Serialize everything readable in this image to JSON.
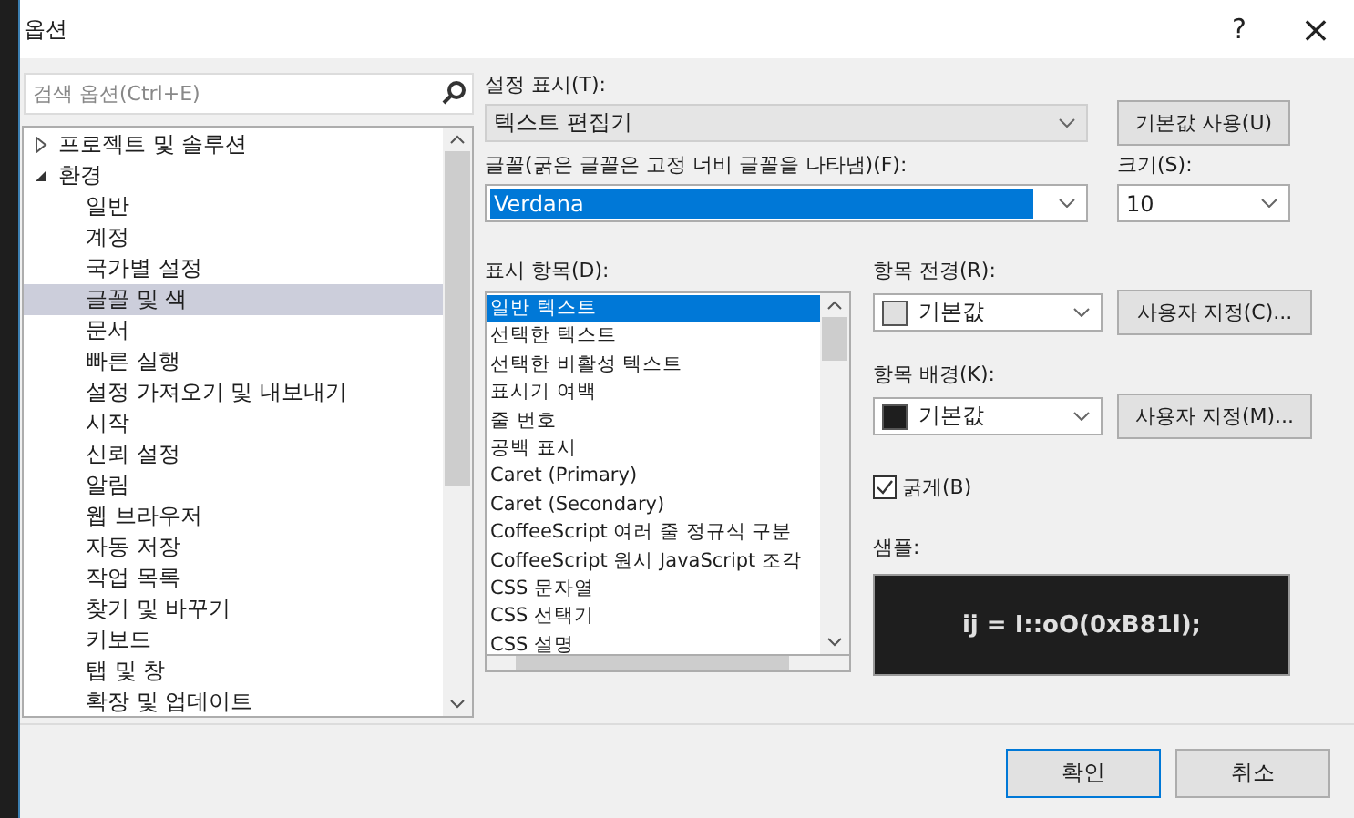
{
  "window": {
    "title": "옵션",
    "help": "?",
    "close": "×"
  },
  "search": {
    "placeholder": "검색 옵션(Ctrl+E)"
  },
  "tree": [
    {
      "label": "프로젝트 및 솔루션",
      "expanded": false,
      "selected": false
    },
    {
      "label": "환경",
      "expanded": true,
      "selected": false,
      "children": [
        {
          "label": "일반",
          "selected": false
        },
        {
          "label": "계정",
          "selected": false
        },
        {
          "label": "국가별 설정",
          "selected": false
        },
        {
          "label": "글꼴 및 색",
          "selected": true
        },
        {
          "label": "문서",
          "selected": false
        },
        {
          "label": "빠른 실행",
          "selected": false
        },
        {
          "label": "설정 가져오기 및 내보내기",
          "selected": false
        },
        {
          "label": "시작",
          "selected": false
        },
        {
          "label": "신뢰 설정",
          "selected": false
        },
        {
          "label": "알림",
          "selected": false
        },
        {
          "label": "웹 브라우저",
          "selected": false
        },
        {
          "label": "자동 저장",
          "selected": false
        },
        {
          "label": "작업 목록",
          "selected": false
        },
        {
          "label": "찾기 및 바꾸기",
          "selected": false
        },
        {
          "label": "키보드",
          "selected": false
        },
        {
          "label": "탭 및 창",
          "selected": false
        },
        {
          "label": "확장 및 업데이트",
          "selected": false
        }
      ]
    }
  ],
  "show_settings": {
    "label": "설정 표시(T):",
    "value": "텍스트 편집기",
    "button": "기본값 사용(U)"
  },
  "font": {
    "label": "글꼴(굵은 글꼴은 고정 너비 글꼴을 나타냄)(F):",
    "value": "Verdana"
  },
  "size": {
    "label": "크기(S):",
    "value": "10"
  },
  "display_items": {
    "label": "표시 항목(D):",
    "items": [
      {
        "label": "일반 텍스트",
        "selected": true
      },
      {
        "label": "선택한 텍스트",
        "selected": false
      },
      {
        "label": "선택한 비활성 텍스트",
        "selected": false
      },
      {
        "label": "표시기 여백",
        "selected": false
      },
      {
        "label": "줄 번호",
        "selected": false
      },
      {
        "label": "공백 표시",
        "selected": false
      },
      {
        "label": "Caret (Primary)",
        "selected": false
      },
      {
        "label": "Caret (Secondary)",
        "selected": false
      },
      {
        "label": "CoffeeScript 여러 줄 정규식 구분",
        "selected": false
      },
      {
        "label": "CoffeeScript 원시 JavaScript 조각",
        "selected": false
      },
      {
        "label": "CSS 문자열",
        "selected": false
      },
      {
        "label": "CSS 선택기",
        "selected": false
      },
      {
        "label": "CSS 설명",
        "selected": false
      }
    ]
  },
  "foreground": {
    "label": "항목 전경(R):",
    "value": "기본값",
    "color": "#e0e0e0",
    "button": "사용자 지정(C)..."
  },
  "background": {
    "label": "항목 배경(K):",
    "value": "기본값",
    "color": "#1e1e1e",
    "button": "사용자 지정(M)..."
  },
  "bold": {
    "label": "굵게(B)",
    "checked": true
  },
  "sample": {
    "label": "샘플:",
    "text": "ij = I::oO(0xB81l);"
  },
  "buttons": [
    {
      "label": "확인",
      "default": true
    },
    {
      "label": "취소",
      "default": false
    }
  ]
}
